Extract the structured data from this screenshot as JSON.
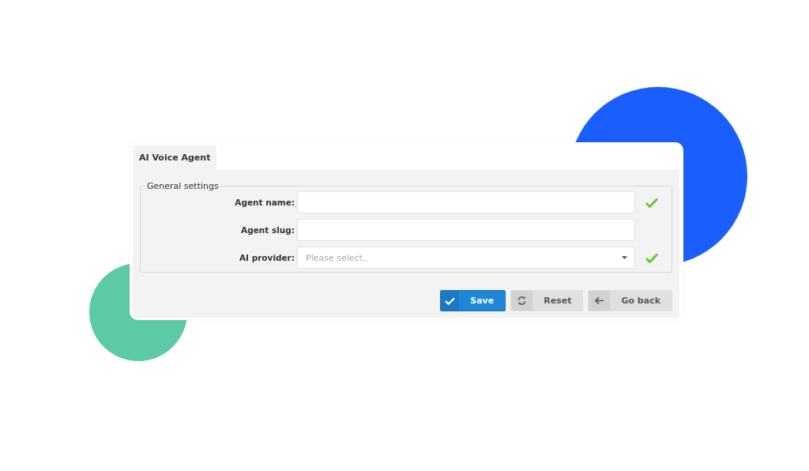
{
  "tabs": [
    {
      "label": "AI Voice Agent",
      "selected": true
    }
  ],
  "fieldset": {
    "legend": "General settings",
    "fields": [
      {
        "label": "Agent name:",
        "kind": "text",
        "valid": true
      },
      {
        "label": "Agent slug:",
        "kind": "text",
        "valid": false
      },
      {
        "label": "AI provider:",
        "kind": "select",
        "placeholder": "Please select..",
        "valid": true
      }
    ]
  },
  "buttons": [
    {
      "label": "Save",
      "kind": "save"
    },
    {
      "label": "Reset",
      "kind": "reset"
    },
    {
      "label": "Go back",
      "kind": "back"
    }
  ]
}
